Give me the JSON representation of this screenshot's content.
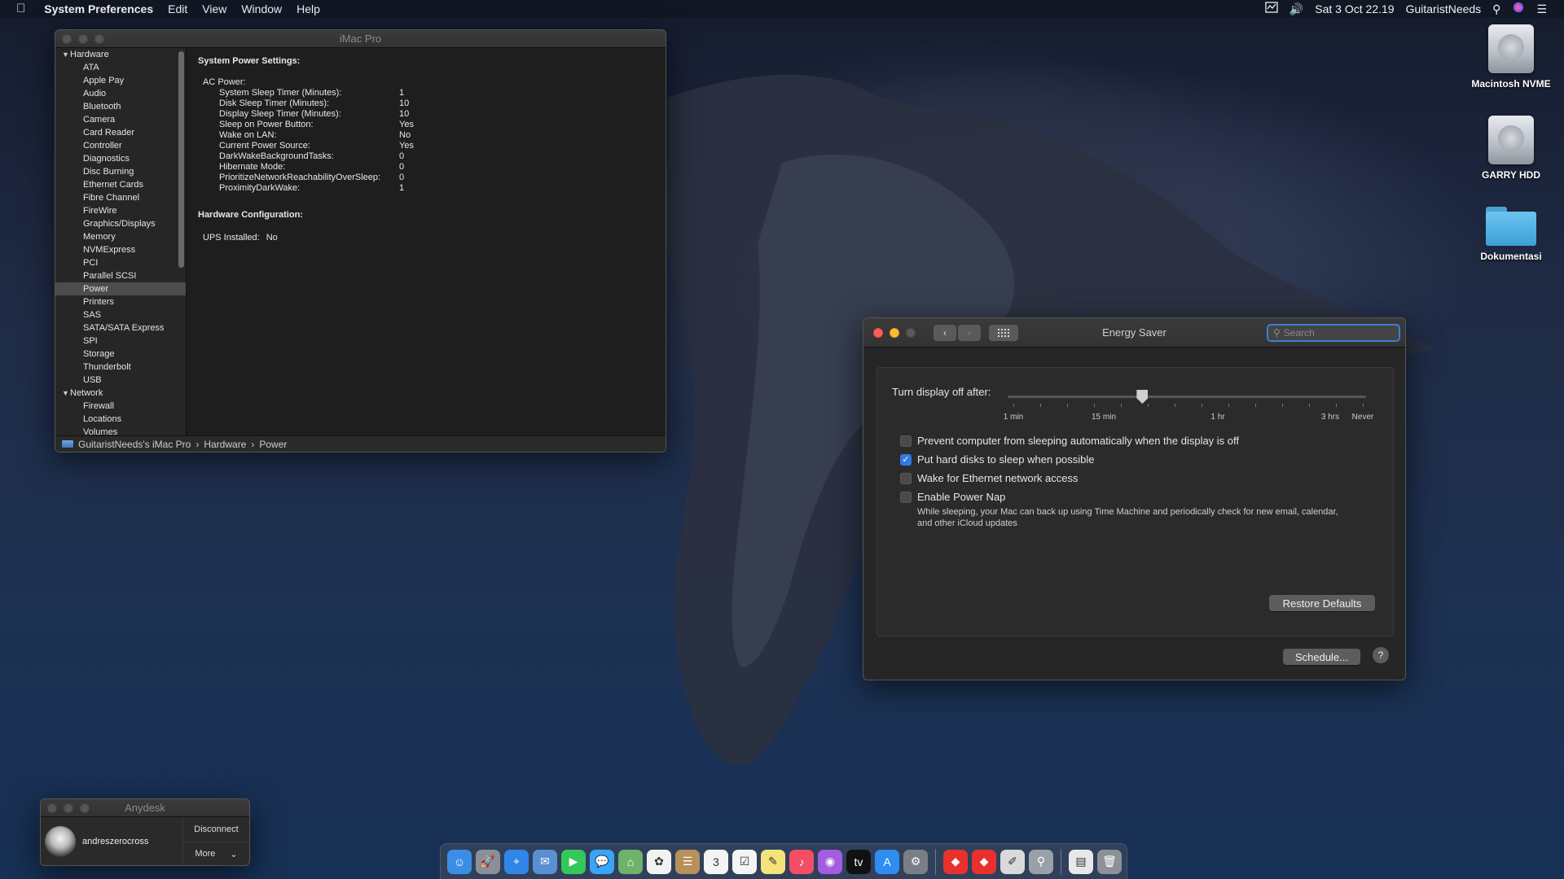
{
  "menubar": {
    "app": "System Preferences",
    "menus": [
      "Edit",
      "View",
      "Window",
      "Help"
    ],
    "datetime": "Sat 3 Oct  22.19",
    "user": "GuitaristNeeds"
  },
  "desktop": {
    "icons": [
      {
        "label": "Macintosh NVME",
        "icon": "hdd-icon"
      },
      {
        "label": "GARRY HDD",
        "icon": "hdd-icon"
      },
      {
        "label": "Dokumentasi",
        "icon": "folder-icon"
      }
    ]
  },
  "sysinfo": {
    "title": "iMac Pro",
    "groups": [
      {
        "label": "Hardware",
        "items": [
          "ATA",
          "Apple Pay",
          "Audio",
          "Bluetooth",
          "Camera",
          "Card Reader",
          "Controller",
          "Diagnostics",
          "Disc Burning",
          "Ethernet Cards",
          "Fibre Channel",
          "FireWire",
          "Graphics/Displays",
          "Memory",
          "NVMExpress",
          "PCI",
          "Parallel SCSI",
          "Power",
          "Printers",
          "SAS",
          "SATA/SATA Express",
          "SPI",
          "Storage",
          "Thunderbolt",
          "USB"
        ]
      },
      {
        "label": "Network",
        "items": [
          "Firewall",
          "Locations",
          "Volumes"
        ]
      }
    ],
    "selected": "Power",
    "heading": "System Power Settings:",
    "ac_power_label": "AC Power:",
    "settings": [
      {
        "k": "System Sleep Timer (Minutes):",
        "v": "1"
      },
      {
        "k": "Disk Sleep Timer (Minutes):",
        "v": "10"
      },
      {
        "k": "Display Sleep Timer (Minutes):",
        "v": "10"
      },
      {
        "k": "Sleep on Power Button:",
        "v": "Yes"
      },
      {
        "k": "Wake on LAN:",
        "v": "No"
      },
      {
        "k": "Current Power Source:",
        "v": "Yes"
      },
      {
        "k": "DarkWakeBackgroundTasks:",
        "v": "0"
      },
      {
        "k": "Hibernate Mode:",
        "v": "0"
      },
      {
        "k": "PrioritizeNetworkReachabilityOverSleep:",
        "v": "0"
      },
      {
        "k": "ProximityDarkWake:",
        "v": "1"
      }
    ],
    "hw_heading": "Hardware Configuration:",
    "ups_label": "UPS Installed:",
    "ups_value": "No",
    "path": [
      "GuitaristNeeds's iMac Pro",
      "Hardware",
      "Power"
    ]
  },
  "energy": {
    "title": "Energy Saver",
    "search_placeholder": "Search",
    "slider_label": "Turn display off after:",
    "slider_value_minutes": 10,
    "tick_labels": [
      "1 min",
      "15 min",
      "1 hr",
      "3 hrs",
      "Never"
    ],
    "options": [
      {
        "label": "Prevent computer from sleeping automatically when the display is off",
        "checked": false
      },
      {
        "label": "Put hard disks to sleep when possible",
        "checked": true
      },
      {
        "label": "Wake for Ethernet network access",
        "checked": false
      },
      {
        "label": "Enable Power Nap",
        "checked": false
      }
    ],
    "power_nap_note": "While sleeping, your Mac can back up using Time Machine and periodically check for new email, calendar, and other iCloud updates",
    "restore_label": "Restore Defaults",
    "schedule_label": "Schedule...",
    "help_label": "?"
  },
  "anydesk": {
    "title": "Anydesk",
    "user": "andreszerocross",
    "disconnect": "Disconnect",
    "more": "More"
  },
  "dock": {
    "apps": [
      {
        "name": "finder",
        "color": "#3a8ee6",
        "glyph": "☺"
      },
      {
        "name": "launchpad",
        "color": "#8a8f99",
        "glyph": "🚀"
      },
      {
        "name": "safari",
        "color": "#2f86e8",
        "glyph": "⌖"
      },
      {
        "name": "mail",
        "color": "#5b8fd4",
        "glyph": "✉"
      },
      {
        "name": "facetime",
        "color": "#34c759",
        "glyph": "▶"
      },
      {
        "name": "messages",
        "color": "#3aa4f5",
        "glyph": "💬"
      },
      {
        "name": "maps",
        "color": "#6fb36a",
        "glyph": "⌂"
      },
      {
        "name": "photos",
        "color": "#f2f2f2",
        "glyph": "✿"
      },
      {
        "name": "contacts",
        "color": "#b8905a",
        "glyph": "☰"
      },
      {
        "name": "calendar",
        "color": "#f4f4f4",
        "glyph": "3"
      },
      {
        "name": "reminders",
        "color": "#f4f4f4",
        "glyph": "☑"
      },
      {
        "name": "notes",
        "color": "#f4e37a",
        "glyph": "✎"
      },
      {
        "name": "music",
        "color": "#f44d66",
        "glyph": "♪"
      },
      {
        "name": "podcasts",
        "color": "#a45ce0",
        "glyph": "◉"
      },
      {
        "name": "tv",
        "color": "#111111",
        "glyph": "tv"
      },
      {
        "name": "app-store",
        "color": "#2f8cf0",
        "glyph": "A"
      },
      {
        "name": "system-preferences",
        "color": "#7a7f87",
        "glyph": "⚙"
      },
      {
        "name": "anydesk",
        "color": "#e8312c",
        "glyph": "◆"
      },
      {
        "name": "anydesk-2",
        "color": "#e8312c",
        "glyph": "◆"
      },
      {
        "name": "preview",
        "color": "#d9d9d9",
        "glyph": "✐"
      },
      {
        "name": "utility",
        "color": "#9aa0a8",
        "glyph": "⚲"
      },
      {
        "name": "document",
        "color": "#e8e8e8",
        "glyph": "▤"
      },
      {
        "name": "trash",
        "color": "#8c9097",
        "glyph": "🗑"
      }
    ]
  }
}
